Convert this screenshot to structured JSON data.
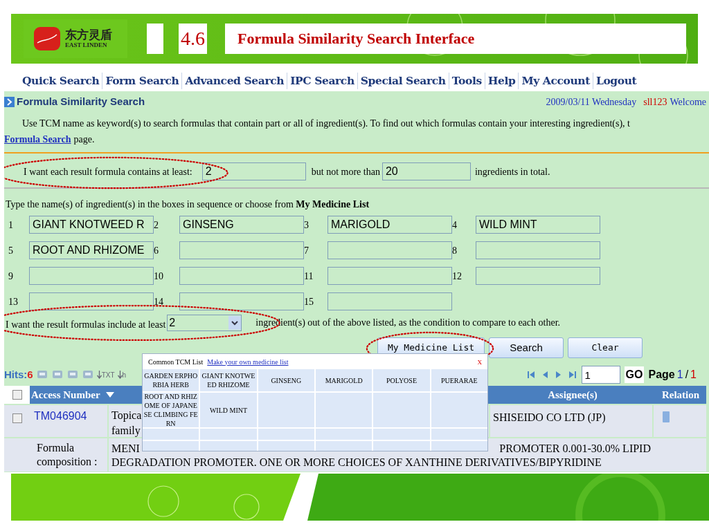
{
  "header": {
    "logo_text": "东方灵盾",
    "logo_subtext": "EAST LINDEN",
    "section_number": "4.6",
    "title": "Formula Similarity Search Interface"
  },
  "nav": [
    {
      "label": "Quick Search"
    },
    {
      "label": "Form Search"
    },
    {
      "label": "Advanced Search"
    },
    {
      "label": "IPC Search"
    },
    {
      "label": "Special Search"
    },
    {
      "label": "Tools"
    },
    {
      "label": "Help"
    },
    {
      "label": "My Account"
    },
    {
      "label": "Logout"
    }
  ],
  "page": {
    "title": "Formula Similarity Search",
    "date": "2009/03/11 Wednesday",
    "user": "sll123",
    "welcome": "Welcome"
  },
  "intro": {
    "text": "Use TCM name as keyword(s) to search formulas that contain part or all of ingredient(s). To find out which formulas contain your interesting ingredient(s), t",
    "link": "Formula Search",
    "after": "page."
  },
  "count_filter": {
    "label": "I want each result formula contains at least:",
    "min": "2",
    "middle": "but not more than",
    "max": "20",
    "suffix": "ingredients in total."
  },
  "ingredients": {
    "instruction": "Type the name(s) of ingredient(s) in the boxes in sequence or choose from **My Medicine List**",
    "slots": [
      {
        "number": "1",
        "value": "GIANT KNOTWEED R"
      },
      {
        "number": "2",
        "value": "GINSENG"
      },
      {
        "number": "3",
        "value": "MARIGOLD"
      },
      {
        "number": "4",
        "value": "WILD MINT"
      },
      {
        "number": "5",
        "value": "ROOT AND RHIZOME"
      },
      {
        "number": "6"
      },
      {
        "number": "7"
      },
      {
        "number": "8"
      },
      {
        "number": "9"
      },
      {
        "number": "10"
      },
      {
        "number": "11"
      },
      {
        "number": "12"
      },
      {
        "number": "13"
      },
      {
        "number": "14"
      },
      {
        "number": "15"
      }
    ]
  },
  "match": {
    "label": "I want the result formulas include at least",
    "value": "2",
    "suffix": "ingredient(s) out of the above listed, as the condition to compare to each other."
  },
  "buttons": [
    {
      "label": "My Medicine List",
      "kind": "mono"
    },
    {
      "label": "Search",
      "kind": "sans"
    },
    {
      "label": "Clear",
      "kind": "mono"
    }
  ],
  "results": {
    "hits_label": "Hits:",
    "hits": "6",
    "export_labels": [
      "TXT",
      "h"
    ],
    "pager": {
      "page_input": "1",
      "go": "GO",
      "page_label": "Page",
      "current": "1",
      "separator": "/",
      "total": "1"
    },
    "columns": {
      "access": "Access Number",
      "assignee": "Assignee(s)",
      "relation": "Relation"
    },
    "header_checked": false,
    "row": {
      "checked": false,
      "access_number": "TM046904",
      "title_lines": [
        "Topica",
        "family"
      ],
      "assignee": "SHISEIDO CO LTD (JP)"
    },
    "composition": {
      "label": "Formula composition :",
      "text_start": "MENI",
      "text_end": "PROMOTER 0.001-30.0% LIPID",
      "line_2": "DEGRADATION PROMOTER. ONE OR MORE CHOICES OF XANTHINE DERIVATIVES/BIPYRIDINE"
    }
  },
  "medicine_popup": {
    "tab": "Common TCM List",
    "link": "Make your own medicine list",
    "close": "x",
    "cells": [
      "GARDEN ERPHORBIA HERB",
      "GIANT KNOTWEED RHIZOME",
      "GINSENG",
      "MARIGOLD",
      "POLYOSE",
      "PUERARAE",
      "ROOT AND RHIZOME OF JAPANESE CLIMBING FERN",
      "WILD MINT"
    ]
  }
}
